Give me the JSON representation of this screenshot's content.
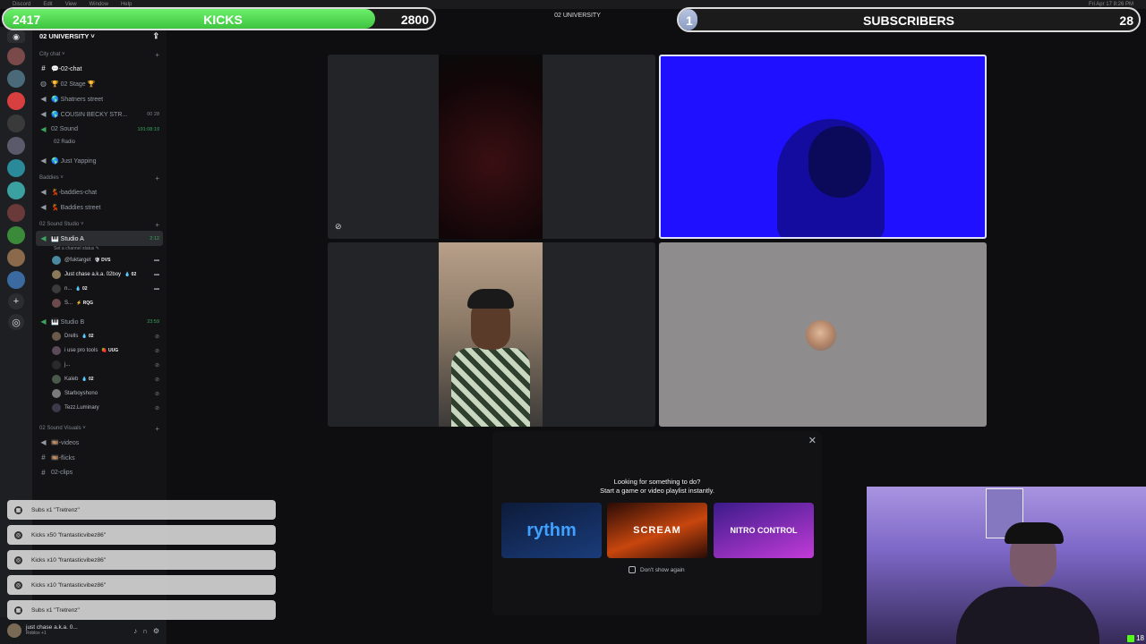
{
  "menubar": {
    "items": [
      "Discord",
      "Edit",
      "View",
      "Window",
      "Help"
    ],
    "clock": "Fri Apr 17 8:26 PM"
  },
  "overlay": {
    "kicks": {
      "current": "2417",
      "title": "KICKS",
      "goal": "2800",
      "progress": 0.863,
      "color": "#4ade4a"
    },
    "subs": {
      "current": "1",
      "title": "SUBSCRIBERS",
      "goal": "28",
      "progress": 0.036
    }
  },
  "topbar": {
    "title": "02 UNIVERSITY"
  },
  "server": {
    "name": "02 UNIVERSITY ˅"
  },
  "categories": {
    "city": "City chat ˅",
    "baddies": "Baddies ˅",
    "studio": "02 Sound Studio ˅",
    "visuals": "02 Sound Visuals ˅"
  },
  "channels": {
    "o2chat": "💬-02-chat",
    "stage": "🏆 02 Stage 🏆",
    "shatners": "🌎 Shatners street",
    "cousin": "🌎 COUSIN BECKY STR...",
    "cousin_meta": "00 28",
    "sound": "02 Sound",
    "sound_meta": "191:08:19",
    "radio": "02 Radio",
    "yapping": "🌎 Just Yapping",
    "baddies_chat": "💃-baddies-chat",
    "baddies_street": "💃 Baddies street",
    "studio_a": "🎹 Studio A",
    "studio_a_meta": "2:12",
    "studio_a_status": "Set a channel status ✎",
    "studio_b": "🎹 Studio B",
    "studio_b_meta": "23:59",
    "videos": "🎞️-videos",
    "flicks": "🎞️-flicks",
    "clips": "02-clips"
  },
  "studio_a_users": [
    {
      "name": "@fuktarget",
      "tag": "🛡 DVS"
    },
    {
      "name": "Just chase a.k.a. 02boy",
      "tag": "💧 02"
    },
    {
      "name": "n...",
      "tag": "💧 02"
    },
    {
      "name": "S...",
      "tag": "⚡ RQG"
    }
  ],
  "studio_b_users": [
    {
      "name": "Drells",
      "tag": "💧 02"
    },
    {
      "name": "i use pro tools",
      "tag": "🍓 UUG"
    },
    {
      "name": "j...",
      "tag": ""
    },
    {
      "name": "Kaleb",
      "tag": "💧 02"
    },
    {
      "name": "Starboyshono",
      "tag": ""
    },
    {
      "name": "Tezz.Luminary",
      "tag": ""
    }
  ],
  "user_panel": {
    "name": "just chase a.k.a. 0...",
    "status": "Roblox +1"
  },
  "activity": {
    "line1": "Looking for something to do?",
    "line2": "Start a game or video playlist instantly.",
    "cards": [
      "rythm",
      "SCREAM",
      "NITRO CONTROL"
    ],
    "dont_show": "Don't show again"
  },
  "toasts": [
    "Subs x1 \"Tretrenz\"",
    "Kicks x50 \"frantasticvibez86\"",
    "Kicks x10 \"frantasticvibez86\"",
    "Kicks x10 \"frantasticvibez86\"",
    "Subs x1 \"Tretrenz\""
  ],
  "facecam": {
    "viewers": "18"
  }
}
